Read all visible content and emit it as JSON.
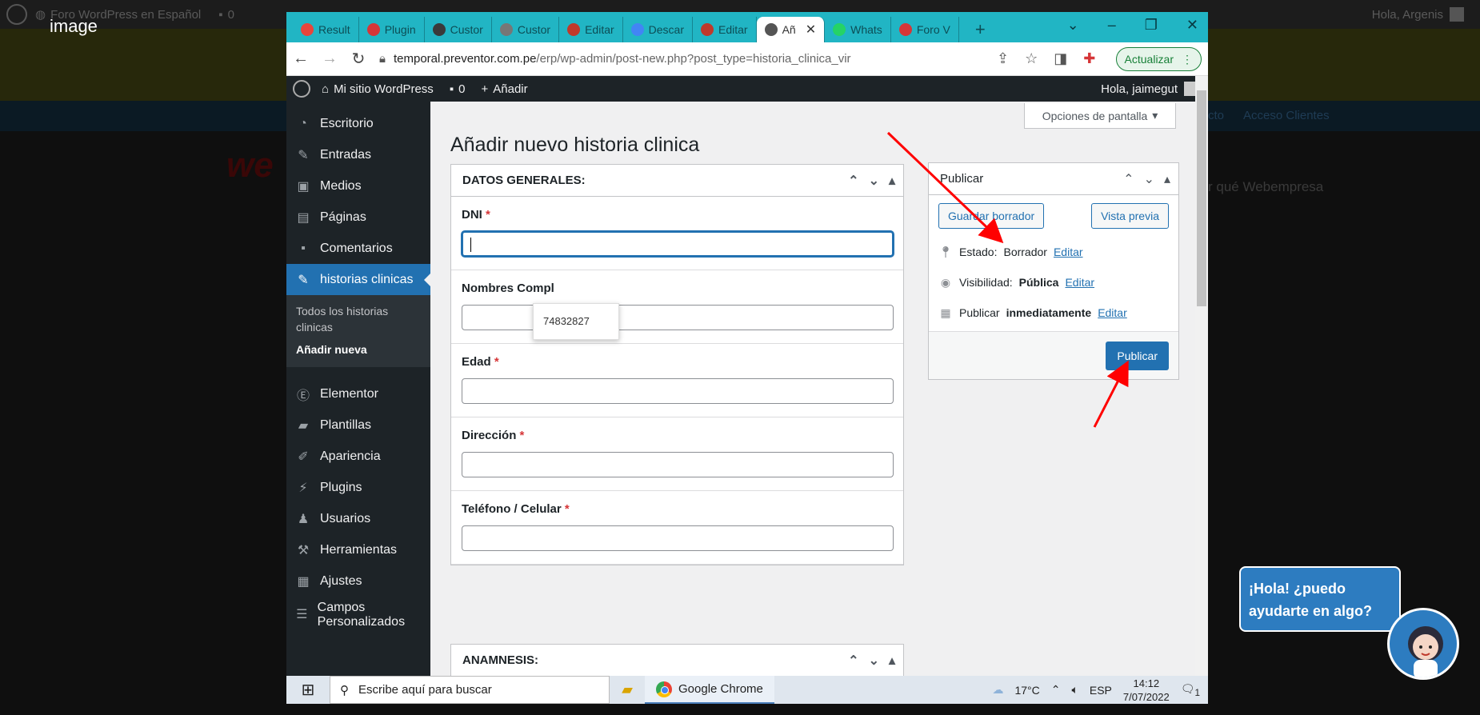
{
  "image_label": "image",
  "background": {
    "site_name": "Foro WordPress en Español",
    "comments": "0",
    "greeting": "Hola, Argenis",
    "logo_text": "we",
    "nav_links": [
      "cto",
      "Acceso Clientes"
    ],
    "why_text": "r qué Webempresa"
  },
  "browser": {
    "tabs": [
      {
        "label": "Result",
        "icon_color": "#e8453c"
      },
      {
        "label": "Plugin",
        "icon_color": "#d63638"
      },
      {
        "label": "Custor",
        "icon_color": "#3a3a3a"
      },
      {
        "label": "Custor",
        "icon_color": "#777777"
      },
      {
        "label": "Editar",
        "icon_color": "#c0392b"
      },
      {
        "label": "Descar",
        "icon_color": "#4285f4"
      },
      {
        "label": "Editar",
        "icon_color": "#c0392b"
      },
      {
        "label": "Añ",
        "icon_color": "#555555",
        "active": true
      },
      {
        "label": "Whats",
        "icon_color": "#25d366"
      },
      {
        "label": "Foro V",
        "icon_color": "#d63638"
      }
    ],
    "url_domain": "temporal.preventor.com.pe",
    "url_path": "/erp/wp-admin/post-new.php?post_type=historia_clinica_vir",
    "update_label": "Actualizar"
  },
  "wpbar": {
    "site": "Mi sitio WordPress",
    "comments": "0",
    "add": "Añadir",
    "greeting": "Hola, jaimegut"
  },
  "sidebar": {
    "items": [
      {
        "label": "Escritorio",
        "icon": "dashboard-icon"
      },
      {
        "label": "Entradas",
        "icon": "pin-icon"
      },
      {
        "label": "Medios",
        "icon": "media-icon"
      },
      {
        "label": "Páginas",
        "icon": "page-icon"
      },
      {
        "label": "Comentarios",
        "icon": "comment-icon"
      },
      {
        "label": "historias clinicas",
        "icon": "pin-icon"
      }
    ],
    "sub": [
      "Todos los historias clinicas",
      "Añadir nueva"
    ],
    "items2": [
      {
        "label": "Elementor",
        "icon": "elementor-icon"
      },
      {
        "label": "Plantillas",
        "icon": "folder-icon"
      },
      {
        "label": "Apariencia",
        "icon": "brush-icon"
      },
      {
        "label": "Plugins",
        "icon": "plugin-icon"
      },
      {
        "label": "Usuarios",
        "icon": "users-icon"
      },
      {
        "label": "Herramientas",
        "icon": "wrench-icon"
      },
      {
        "label": "Ajustes",
        "icon": "settings-icon"
      },
      {
        "label": "Campos Personalizados",
        "icon": "fields-icon"
      }
    ]
  },
  "main": {
    "screen_options": "Opciones de pantalla",
    "title": "Añadir nuevo historia clinica",
    "box1_title": "DATOS GENERALES:",
    "fields": [
      {
        "label": "DNI",
        "value": ""
      },
      {
        "label": "Nombres Compl",
        "value": ""
      },
      {
        "label": "Edad",
        "value": ""
      },
      {
        "label": "Dirección",
        "value": ""
      },
      {
        "label": "Teléfono / Celular",
        "value": ""
      }
    ],
    "required_mark": "*",
    "autocomplete": "74832827",
    "box2_title": "ANAMNESIS:"
  },
  "publish": {
    "title": "Publicar",
    "save_draft": "Guardar borrador",
    "preview": "Vista previa",
    "status_label": "Estado:",
    "status_value": "Borrador",
    "visibility_label": "Visibilidad:",
    "visibility_value": "Pública",
    "publish_label": "Publicar",
    "publish_value": "inmediatamente",
    "edit": "Editar",
    "publish_button": "Publicar"
  },
  "taskbar": {
    "search_placeholder": "Escribe aquí para buscar",
    "chrome": "Google Chrome",
    "temp": "17°C",
    "lang": "ESP",
    "time": "14:12",
    "date": "7/07/2022",
    "notifications": "1"
  },
  "chat": {
    "message": "¡Hola! ¿puedo ayudarte en algo?"
  },
  "colors": {
    "accent": "#2271b1",
    "tabbar": "#21b5c4",
    "wp_dark": "#1d2327",
    "annotation": "#ff0000"
  }
}
